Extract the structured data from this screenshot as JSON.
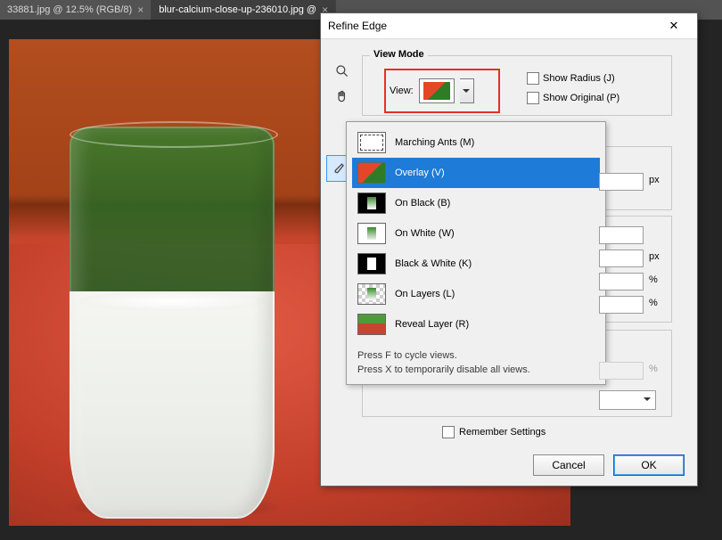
{
  "tabs": [
    {
      "label": "33881.jpg @ 12.5% (RGB/8)",
      "active": false
    },
    {
      "label": "blur-calcium-close-up-236010.jpg @ ",
      "suffix_hidden": "",
      "active": true
    }
  ],
  "dialog": {
    "title": "Refine Edge",
    "view_mode_legend": "View Mode",
    "view_label": "View:",
    "show_radius_label": "Show Radius (J)",
    "show_original_label": "Show Original (P)",
    "dropdown": {
      "items": [
        {
          "label": "Marching Ants (M)",
          "thumb": "th-ma"
        },
        {
          "label": "Overlay (V)",
          "thumb": "th-ov",
          "selected": true
        },
        {
          "label": "On Black (B)",
          "thumb": "th-ob"
        },
        {
          "label": "On White (W)",
          "thumb": "th-ow"
        },
        {
          "label": "Black & White (K)",
          "thumb": "th-bw"
        },
        {
          "label": "On Layers (L)",
          "thumb": "th-ol"
        },
        {
          "label": "Reveal Layer (R)",
          "thumb": "th-rl"
        }
      ],
      "note1": "Press F to cycle views.",
      "note2": "Press X to temporarily disable all views."
    },
    "units": {
      "px": "px",
      "pct": "%"
    },
    "remember_label": "Remember Settings",
    "buttons": {
      "cancel": "Cancel",
      "ok": "OK"
    }
  },
  "tools": {
    "zoom": "zoom-icon",
    "hand": "hand-icon",
    "refine_brush": "refine-brush-icon"
  }
}
